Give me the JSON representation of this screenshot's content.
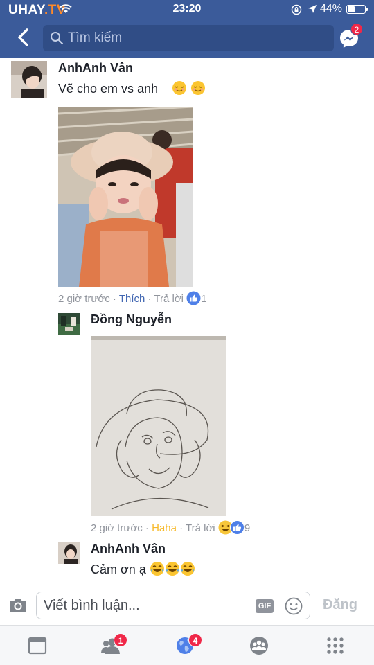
{
  "status_bar": {
    "carrier": "UHAY",
    "carrier_suffix": ".TV",
    "time": "23:20",
    "battery": "44%"
  },
  "header": {
    "search_placeholder": "Tìm kiếm",
    "messenger_badge": "2"
  },
  "comments": [
    {
      "name": "AnhAnh Vân",
      "text": "Vẽ cho em vs anh",
      "time": "2 giờ trước",
      "action": "Thích",
      "reply": "Trả lời",
      "reaction_count": "1"
    },
    {
      "name": "Đồng Nguyễn",
      "time": "2 giờ trước",
      "action": "Haha",
      "reply": "Trả lời",
      "reaction_count": "9"
    },
    {
      "name": "AnhAnh Vân",
      "text": "Cảm ơn ạ"
    }
  ],
  "composer": {
    "placeholder": "Viết bình luận...",
    "gif": "GIF",
    "post": "Đăng"
  },
  "tabbar": {
    "friends_badge": "1",
    "notifications_badge": "4"
  },
  "separator": "·",
  "colors": {
    "header": "#3b5b9a",
    "like": "#4267b2",
    "haha": "#f7b928",
    "badge": "#f02849"
  }
}
